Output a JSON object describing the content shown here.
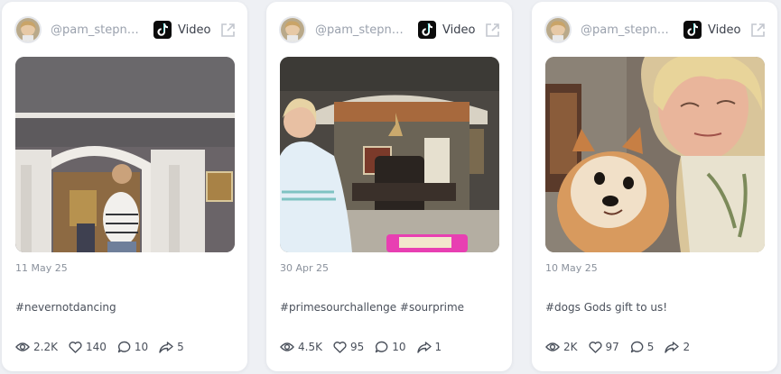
{
  "posts": [
    {
      "handle": "@pam_stepni…",
      "platform_icon": "tiktok-icon",
      "type": "Video",
      "date": "11 May 25",
      "caption": "#nevernotdancing",
      "stats": {
        "views": "2.2K",
        "likes": "140",
        "comments": "10",
        "shares": "5"
      }
    },
    {
      "handle": "@pam_stepni…",
      "platform_icon": "tiktok-icon",
      "type": "Video",
      "date": "30 Apr 25",
      "caption": "#primesourchallenge #sourprime",
      "stats": {
        "views": "4.5K",
        "likes": "95",
        "comments": "10",
        "shares": "1"
      }
    },
    {
      "handle": "@pam_stepni…",
      "platform_icon": "tiktok-icon",
      "type": "Video",
      "date": "10 May 25",
      "caption": "#dogs Gods gift to us!",
      "stats": {
        "views": "2K",
        "likes": "97",
        "comments": "5",
        "shares": "2"
      }
    }
  ],
  "colors": {
    "background": "#eef0f4",
    "card": "#ffffff",
    "muted_text": "#8a919c",
    "body_text": "#4a505b"
  }
}
